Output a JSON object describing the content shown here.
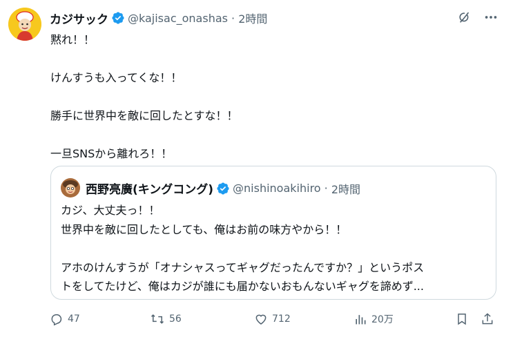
{
  "post": {
    "author_name": "カジサック",
    "handle": "@kajisac_onashas",
    "time": "2時間",
    "lines": [
      "黙れ！！",
      "",
      "けんすうも入ってくな！！",
      "",
      "勝手に世界中を敵に回したとすな！！",
      "",
      "一旦SNSから離れろ！！"
    ]
  },
  "quote": {
    "author_name": "西野亮廣(キングコング)",
    "handle": "@nishinoakihiro",
    "time": "2時間",
    "lines": [
      "カジ、大丈夫っ！！",
      "世界中を敵に回したとしても、俺はお前の味方やから！！",
      "",
      "アホのけんすうが「オナシャスってギャグだったんですか？」というポス",
      "トをしてたけど、俺はカジが誰にも届かないおもんないギャグを諦めず..."
    ]
  },
  "actions": {
    "replies": "47",
    "reposts": "56",
    "likes": "712",
    "views": "20万"
  },
  "colors": {
    "verified": "#1d9bf0",
    "muted": "#536471",
    "border": "#cfd9de"
  },
  "icons": [
    "grok-icon",
    "more-icon",
    "verified-icon",
    "reply-icon",
    "repost-icon",
    "like-icon",
    "views-icon",
    "bookmark-icon",
    "share-icon"
  ]
}
